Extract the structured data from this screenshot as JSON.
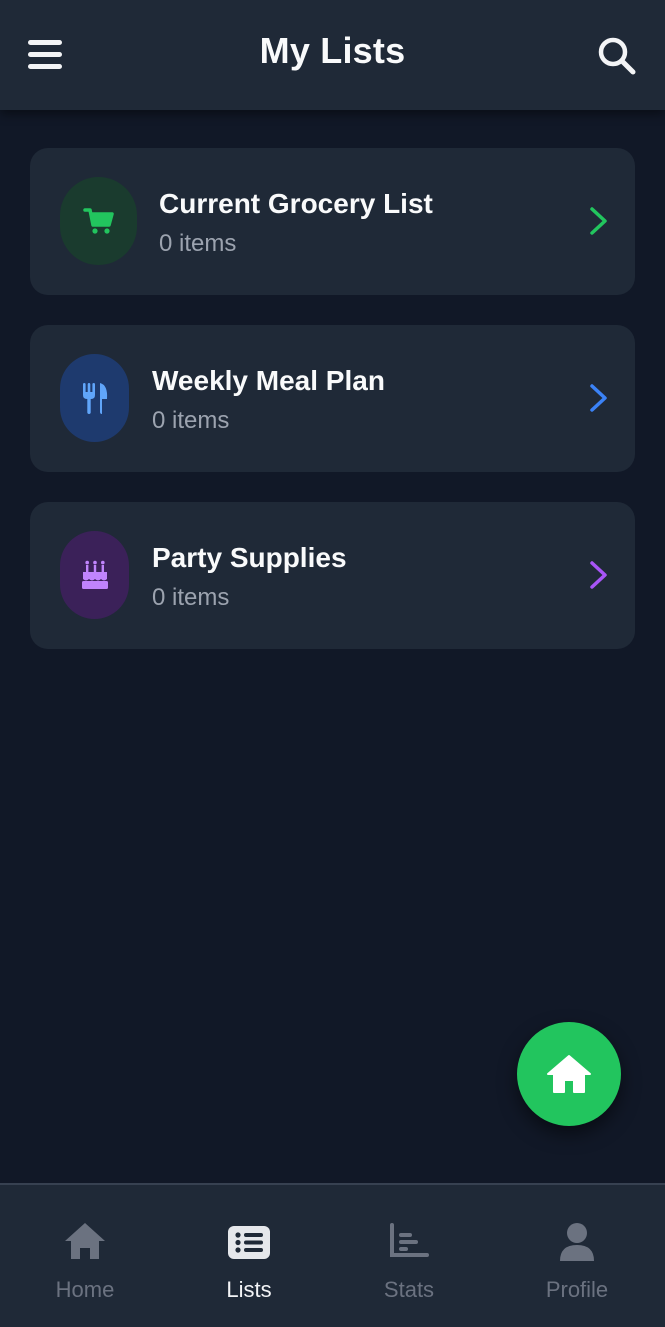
{
  "header": {
    "title": "My Lists",
    "menu_icon": "menu-icon",
    "search_icon": "search-icon"
  },
  "lists": [
    {
      "title": "Current Grocery List",
      "count": "0 items",
      "icon": "shopping-cart-icon",
      "accent": "#22c55e",
      "icon_bg": "#1a3b2e"
    },
    {
      "title": "Weekly Meal Plan",
      "count": "0 items",
      "icon": "utensils-icon",
      "accent": "#3b82f6",
      "icon_bg": "#1e3a6e"
    },
    {
      "title": "Party Supplies",
      "count": "0 items",
      "icon": "birthday-cake-icon",
      "accent": "#a855f7",
      "icon_bg": "#3b2159"
    }
  ],
  "fab": {
    "icon": "home-icon",
    "color": "#22c55e"
  },
  "bottom_nav": {
    "items": [
      {
        "label": "Home",
        "icon": "home-icon",
        "active": false
      },
      {
        "label": "Lists",
        "icon": "list-icon",
        "active": true
      },
      {
        "label": "Stats",
        "icon": "bar-chart-icon",
        "active": false
      },
      {
        "label": "Profile",
        "icon": "user-icon",
        "active": false
      }
    ]
  }
}
